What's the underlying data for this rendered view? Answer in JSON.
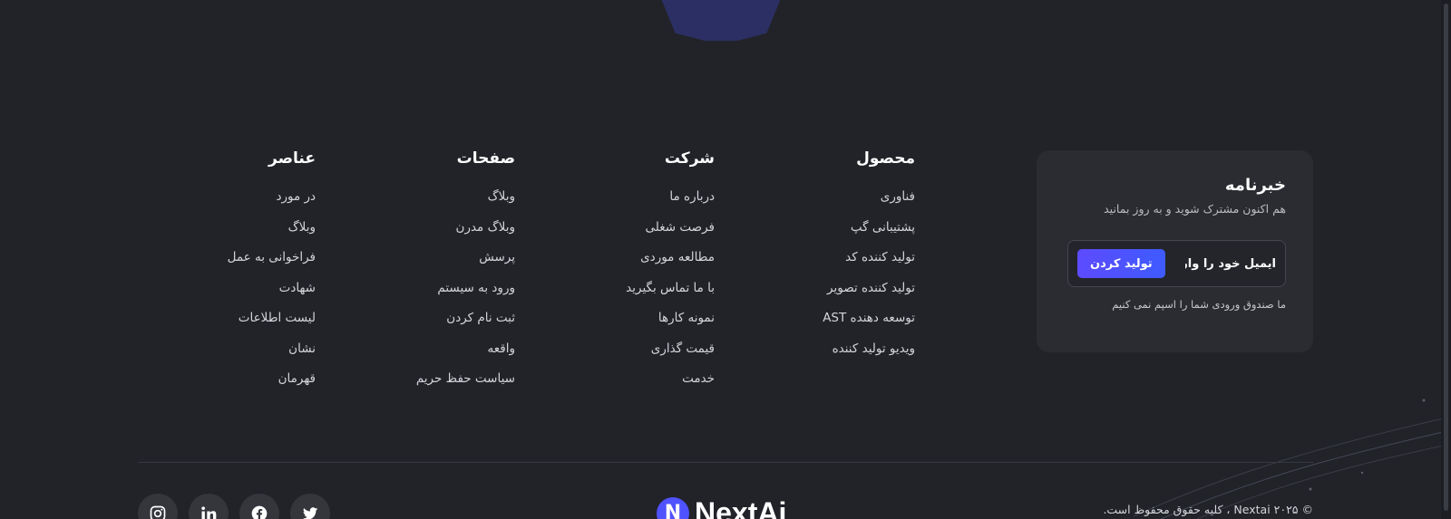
{
  "columns": {
    "product": {
      "title": "محصول",
      "items": [
        "فناوری",
        "پشتیبانی گپ",
        "تولید کننده کد",
        "تولید کننده تصویر",
        "توسعه دهنده AST",
        "ویدیو تولید کننده"
      ]
    },
    "company": {
      "title": "شرکت",
      "items": [
        "درباره ما",
        "فرصت شغلی",
        "مطالعه موردی",
        "با ما تماس بگیرید",
        "نمونه کارها",
        "قیمت گذاری",
        "خدمت"
      ]
    },
    "pages": {
      "title": "صفحات",
      "items": [
        "وبلاگ",
        "وبلاگ مدرن",
        "پرسش",
        "ورود به سیستم",
        "ثبت نام کردن",
        "واقعه",
        "سیاست حفظ حریم"
      ]
    },
    "elements": {
      "title": "عناصر",
      "items": [
        "در مورد",
        "وبلاگ",
        "فراخوانی به عمل",
        "شهادت",
        "لیست اطلاعات",
        "نشان",
        "قهرمان"
      ]
    }
  },
  "newsletter": {
    "title": "خبرنامه",
    "subtitle": "هم اکنون مشترک شوید و به روز بمانید",
    "email_placeholder": "ایمیل خود را وارد کنید",
    "submit_label": "تولید کردن",
    "note": "ما صندوق ورودی شما را اسپم نمی کنیم"
  },
  "brand": {
    "logo_text": "NextAi",
    "accent": "#4f52ff"
  },
  "copyright": "© Nextai ۲۰۲۵ ، کلیه حقوق محفوظ است.",
  "social": [
    "twitter-icon",
    "facebook-icon",
    "linkedin-icon",
    "instagram-icon"
  ]
}
